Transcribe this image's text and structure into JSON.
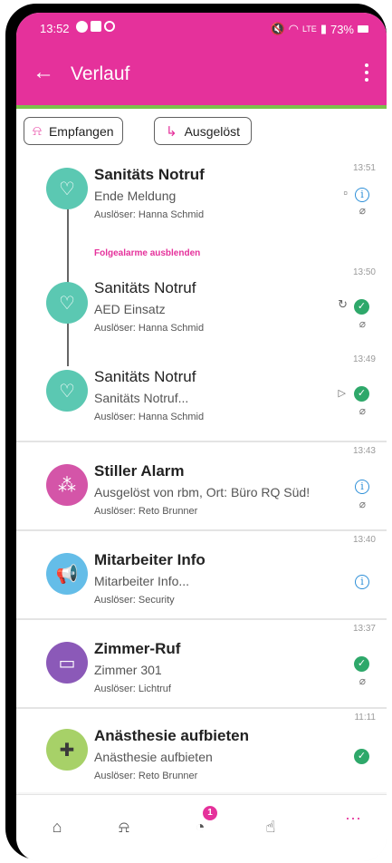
{
  "status_bar": {
    "time": "13:52",
    "battery": "73%",
    "network": "LTE"
  },
  "app_bar": {
    "title": "Verlauf"
  },
  "filters": {
    "received": "Empfangen",
    "triggered": "Ausgelöst"
  },
  "thread": {
    "toggle_label": "Folgealarme ausblenden",
    "items": [
      {
        "time": "13:51",
        "title": "Sanitäts Notruf",
        "subtitle": "Ende Meldung",
        "trigger": "Auslöser: Hanna Schmid",
        "state": "stopped",
        "status": "info"
      },
      {
        "time": "13:50",
        "title": "Sanitäts Notruf",
        "subtitle": "AED Einsatz",
        "trigger": "Auslöser: Hanna Schmid",
        "state": "repeat",
        "status": "ok"
      },
      {
        "time": "13:49",
        "title": "Sanitäts Notruf",
        "subtitle": "Sanitäts Notruf...",
        "trigger": "Auslöser: Hanna Schmid",
        "state": "play",
        "status": "ok"
      }
    ],
    "avatar_color": "#5bc8b2"
  },
  "alarms": [
    {
      "time": "13:43",
      "title": "Stiller Alarm",
      "subtitle": "Ausgelöst von rbm, Ort: Büro RQ Süd!",
      "trigger": "Auslöser: Reto Brunner",
      "status": "info",
      "color": "#d455a8",
      "icon": "network-icon"
    },
    {
      "time": "13:40",
      "title": "Mitarbeiter Info",
      "subtitle": "Mitarbeiter Info...",
      "trigger": "Auslöser: Security",
      "status": "info",
      "color": "#64bde8",
      "icon": "megaphone-icon"
    },
    {
      "time": "13:37",
      "title": "Zimmer-Ruf",
      "subtitle": "Zimmer 301",
      "trigger": "Auslöser: Lichtruf",
      "status": "ok",
      "color": "#8b59b8",
      "icon": "bed-icon"
    },
    {
      "time": "11:11",
      "title": "Anästhesie aufbieten",
      "subtitle": "Anästhesie aufbieten",
      "trigger": "Auslöser: Reto Brunner",
      "status": "ok",
      "color": "#a7d168",
      "icon": "medical-cross-icon"
    }
  ],
  "bottom_nav": {
    "badge_count": "1",
    "more": "···"
  },
  "colors": {
    "brand": "#e5319b",
    "accent_green": "#7cc04b",
    "ok": "#2ea86a",
    "info": "#2d8fd8"
  }
}
